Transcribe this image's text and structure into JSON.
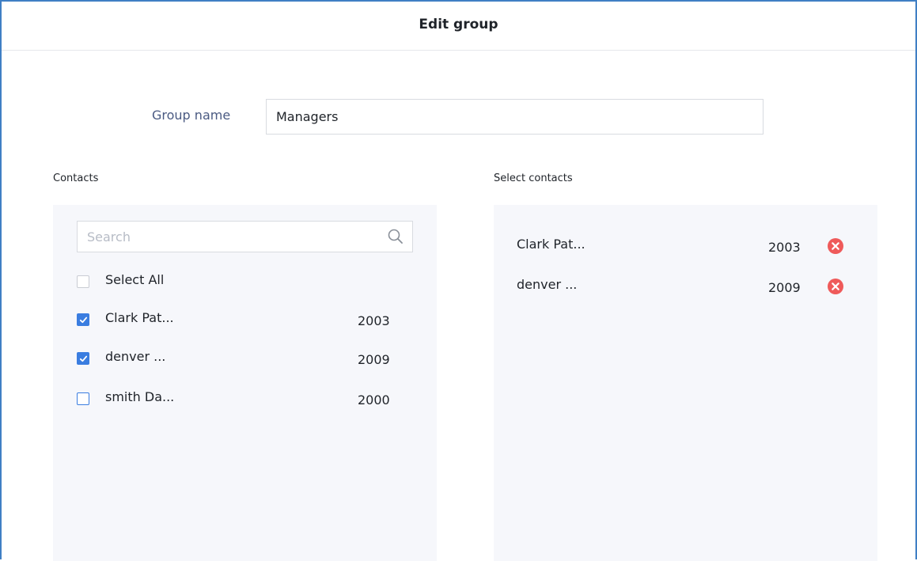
{
  "dialog": {
    "title": "Edit group"
  },
  "group_name": {
    "label": "Group name",
    "value": "Managers"
  },
  "contacts": {
    "label": "Contacts",
    "search_placeholder": "Search",
    "select_all_label": "Select All",
    "items": [
      {
        "name": "Clark Pat...",
        "id": "2003",
        "checked": true
      },
      {
        "name": "denver ...",
        "id": "2009",
        "checked": true
      },
      {
        "name": "smith Da...",
        "id": "2000",
        "checked": false
      }
    ]
  },
  "selected": {
    "label": "Select contacts",
    "items": [
      {
        "name": "Clark Pat...",
        "id": "2003"
      },
      {
        "name": "denver ...",
        "id": "2009"
      }
    ]
  },
  "colors": {
    "accent": "#3a7de0",
    "remove": "#ef5a5a",
    "panel_bg": "#f6f7fb",
    "label_blue": "#4a5a82"
  },
  "icons": {
    "search": "search-icon",
    "remove": "remove-circle-x-icon",
    "check": "checkmark-icon"
  }
}
